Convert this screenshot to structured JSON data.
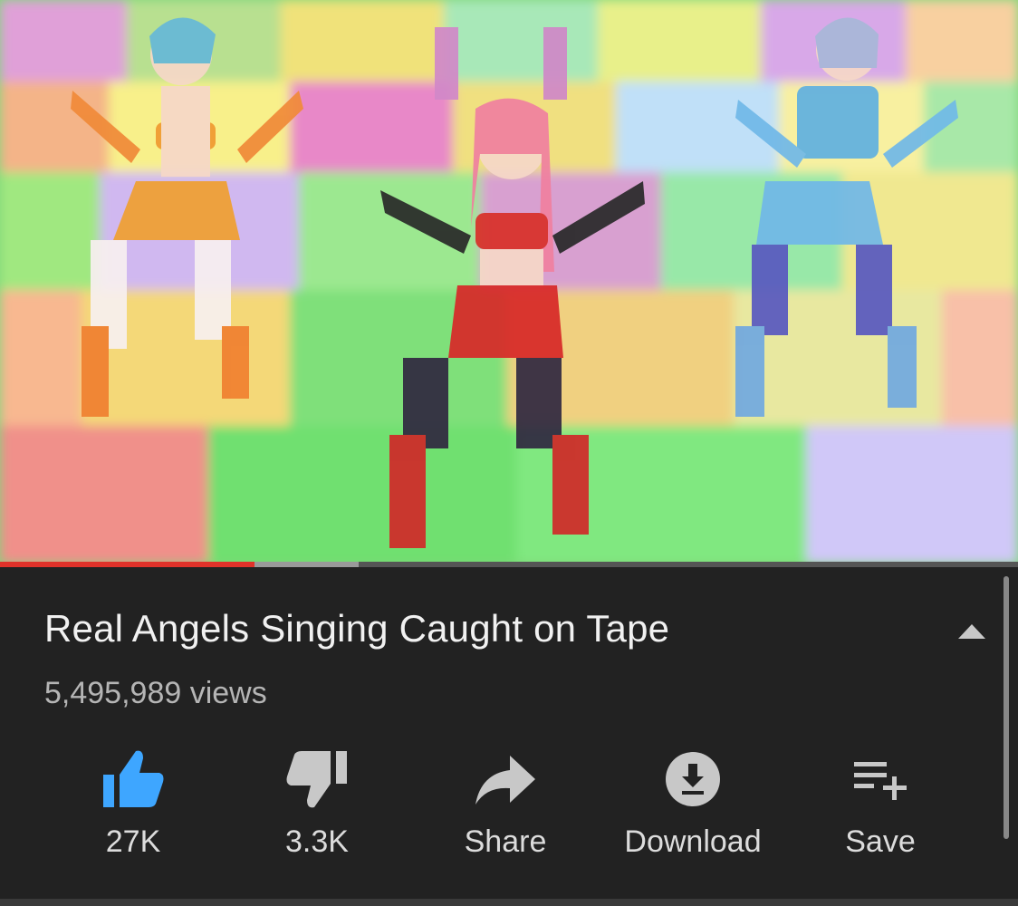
{
  "video": {
    "thumbnail_description_icon": "video-frame",
    "progress_played_fraction": 0.25,
    "progress_buffered_fraction": 0.352
  },
  "meta": {
    "title": "Real Angels Singing Caught on Tape",
    "views": "5,495,989 views"
  },
  "actions": [
    {
      "label": "27K",
      "icon": "thumbs-up-icon",
      "color": "#3ea6ff"
    },
    {
      "label": "3.3K",
      "icon": "thumbs-down-icon",
      "color": "#c8c8c8"
    },
    {
      "label": "Share",
      "icon": "share-icon",
      "color": "#c8c8c8"
    },
    {
      "label": "Download",
      "icon": "download-icon",
      "color": "#c8c8c8"
    },
    {
      "label": "Save",
      "icon": "playlist-add-icon",
      "color": "#c8c8c8"
    }
  ],
  "colors": {
    "background": "#222222",
    "progress_played": "#e0322a",
    "like_active": "#3ea6ff"
  }
}
